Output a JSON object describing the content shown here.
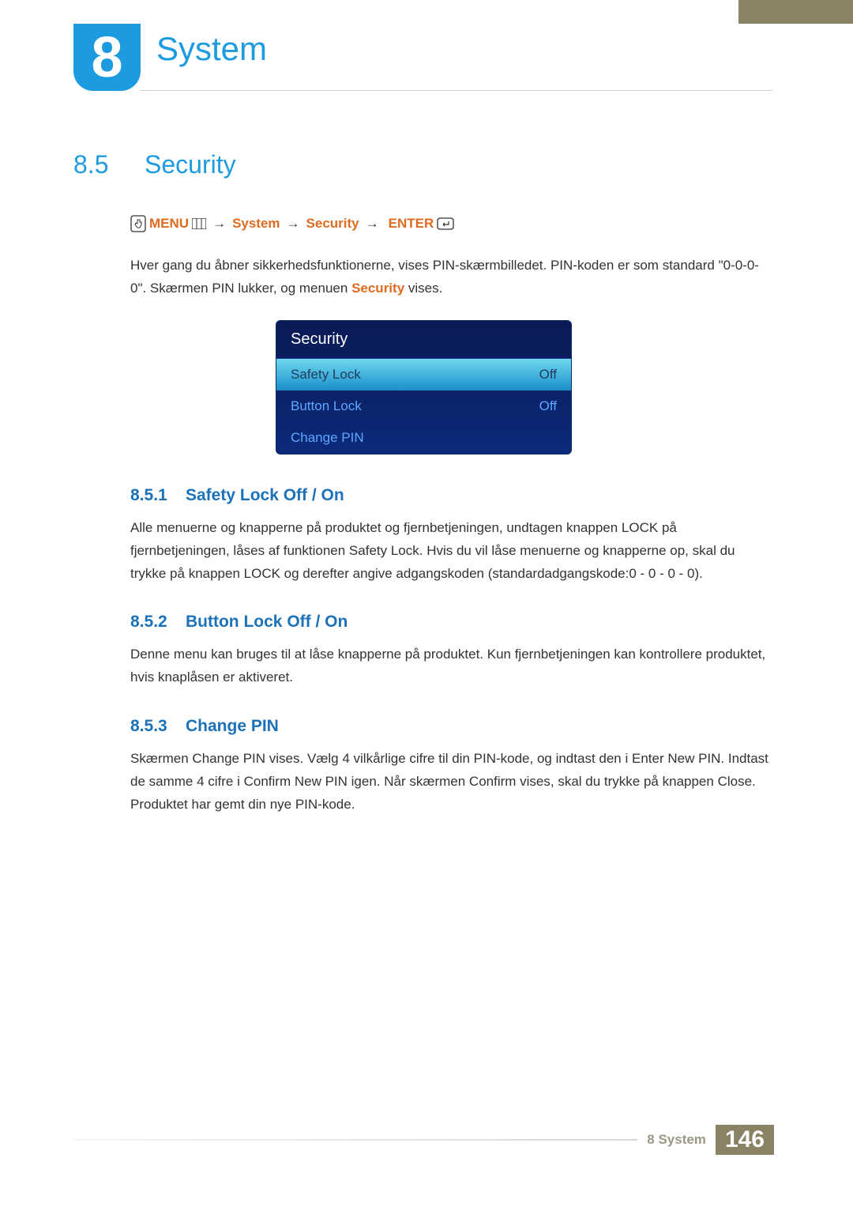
{
  "chapter": {
    "number": "8",
    "title": "System"
  },
  "section": {
    "number": "8.5",
    "title": "Security"
  },
  "breadcrumb": {
    "menu": "MENU",
    "arrow": "→",
    "system": "System",
    "security": "Security",
    "enter": "ENTER"
  },
  "intro": {
    "p1a": "Hver gang du åbner sikkerhedsfunktionerne, vises PIN-skærmbilledet. PIN-koden er som standard \"0-0-0-0\". Skærmen PIN lukker, og menuen ",
    "p1b": "Security",
    "p1c": " vises."
  },
  "menu_panel": {
    "title": "Security",
    "rows": [
      {
        "label": "Safety Lock",
        "value": "Off",
        "highlight": true
      },
      {
        "label": "Button Lock",
        "value": "Off",
        "highlight": false
      },
      {
        "label": "Change PIN",
        "value": "",
        "highlight": false
      }
    ]
  },
  "sub1": {
    "num": "8.5.1",
    "title": "Safety Lock Off / On",
    "t1": "Alle menuerne og knapperne på produktet og fjernbetjeningen, undtagen knappen ",
    "b1": "LOCK",
    "t2": " på fjernbetjeningen, låses af funktionen ",
    "o1": "Safety Lock",
    "t3": ". Hvis du vil låse menuerne og knapperne op, skal du trykke på knappen ",
    "b2": "LOCK",
    "t4": " og derefter angive adgangskoden (standardadgangskode:0 - 0 - 0 - 0)."
  },
  "sub2": {
    "num": "8.5.2",
    "title": "Button Lock Off / On",
    "t1": "Denne menu kan bruges til at låse knapperne på produktet. Kun fjernbetjeningen kan kontrollere produktet, hvis knaplåsen er aktiveret."
  },
  "sub3": {
    "num": "8.5.3",
    "title": "Change PIN",
    "t1": "Skærmen ",
    "o1": "Change PIN",
    "t2": " vises. Vælg 4 vilkårlige cifre til din PIN-kode, og indtast den i ",
    "o2": "Enter New PIN",
    "t3": ". Indtast de samme 4 cifre i ",
    "o3": "Confirm New PIN",
    "t4": " igen. Når skærmen Confirm vises, skal du trykke på knappen ",
    "o4": "Close",
    "t5": ". Produktet har gemt din nye PIN-kode."
  },
  "footer": {
    "label": "8 System",
    "page": "146"
  }
}
